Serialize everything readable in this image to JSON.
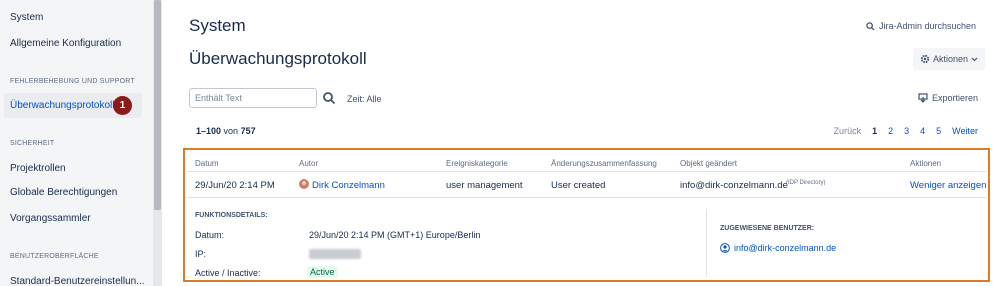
{
  "sidebar": {
    "items": [
      {
        "label": "System"
      },
      {
        "label": "Allgemeine Konfiguration"
      },
      {
        "label": "Überwachungsprotokoll"
      },
      {
        "label": "Projektrollen"
      },
      {
        "label": "Globale Berechtigungen"
      },
      {
        "label": "Vorgangssammler"
      },
      {
        "label": "Standard-Benutzereinstellun..."
      }
    ],
    "sections": [
      {
        "label": "FEHLERBEHEBUNG UND SUPPORT"
      },
      {
        "label": "SICHERHEIT"
      },
      {
        "label": "BENUTZEROBERFLÄCHE"
      }
    ],
    "badge": "1"
  },
  "header": {
    "title": "System",
    "admin_search": "Jira-Admin durchsuchen",
    "subtitle": "Überwachungsprotokoll",
    "actions_label": "Aktionen"
  },
  "filter": {
    "search_placeholder": "Enthält Text",
    "time_label": "Zeit: Alle",
    "export_label": "Exportieren"
  },
  "results": {
    "range": "1–100",
    "of_label": "von",
    "total": "757"
  },
  "pagination": {
    "prev": "Zurück",
    "pages": [
      "1",
      "2",
      "3",
      "4",
      "5"
    ],
    "current": "1",
    "next": "Weiter"
  },
  "table": {
    "columns": [
      "Datum",
      "Autor",
      "Ereigniskategorie",
      "Änderungszusammenfassung",
      "Objekt geändert",
      "Aktionen"
    ],
    "row": {
      "date": "29/Jun/20 2:14 PM",
      "author": "Dirk Conzelmann",
      "category": "user management",
      "summary": "User created",
      "object": "info@dirk-conzelmann.de",
      "object_source": "(IDP Directory)",
      "action": "Weniger anzeigen"
    }
  },
  "details": {
    "heading": "FUNKTIONSDETAILS:",
    "date_label": "Datum:",
    "date_value": "29/Jun/20 2:14 PM (GMT+1) Europe/Berlin",
    "ip_label": "IP:",
    "status_label": "Active / Inactive:",
    "status_value": "Active",
    "assigned_heading": "ZUGEWIESENE BENUTZER:",
    "assigned_user": "info@dirk-conzelmann.de"
  },
  "colors": {
    "link": "#0052cc",
    "highlight_border": "#e07b25",
    "badge": "#8b1a1a",
    "active_lozenge_bg": "#e3fcef"
  }
}
